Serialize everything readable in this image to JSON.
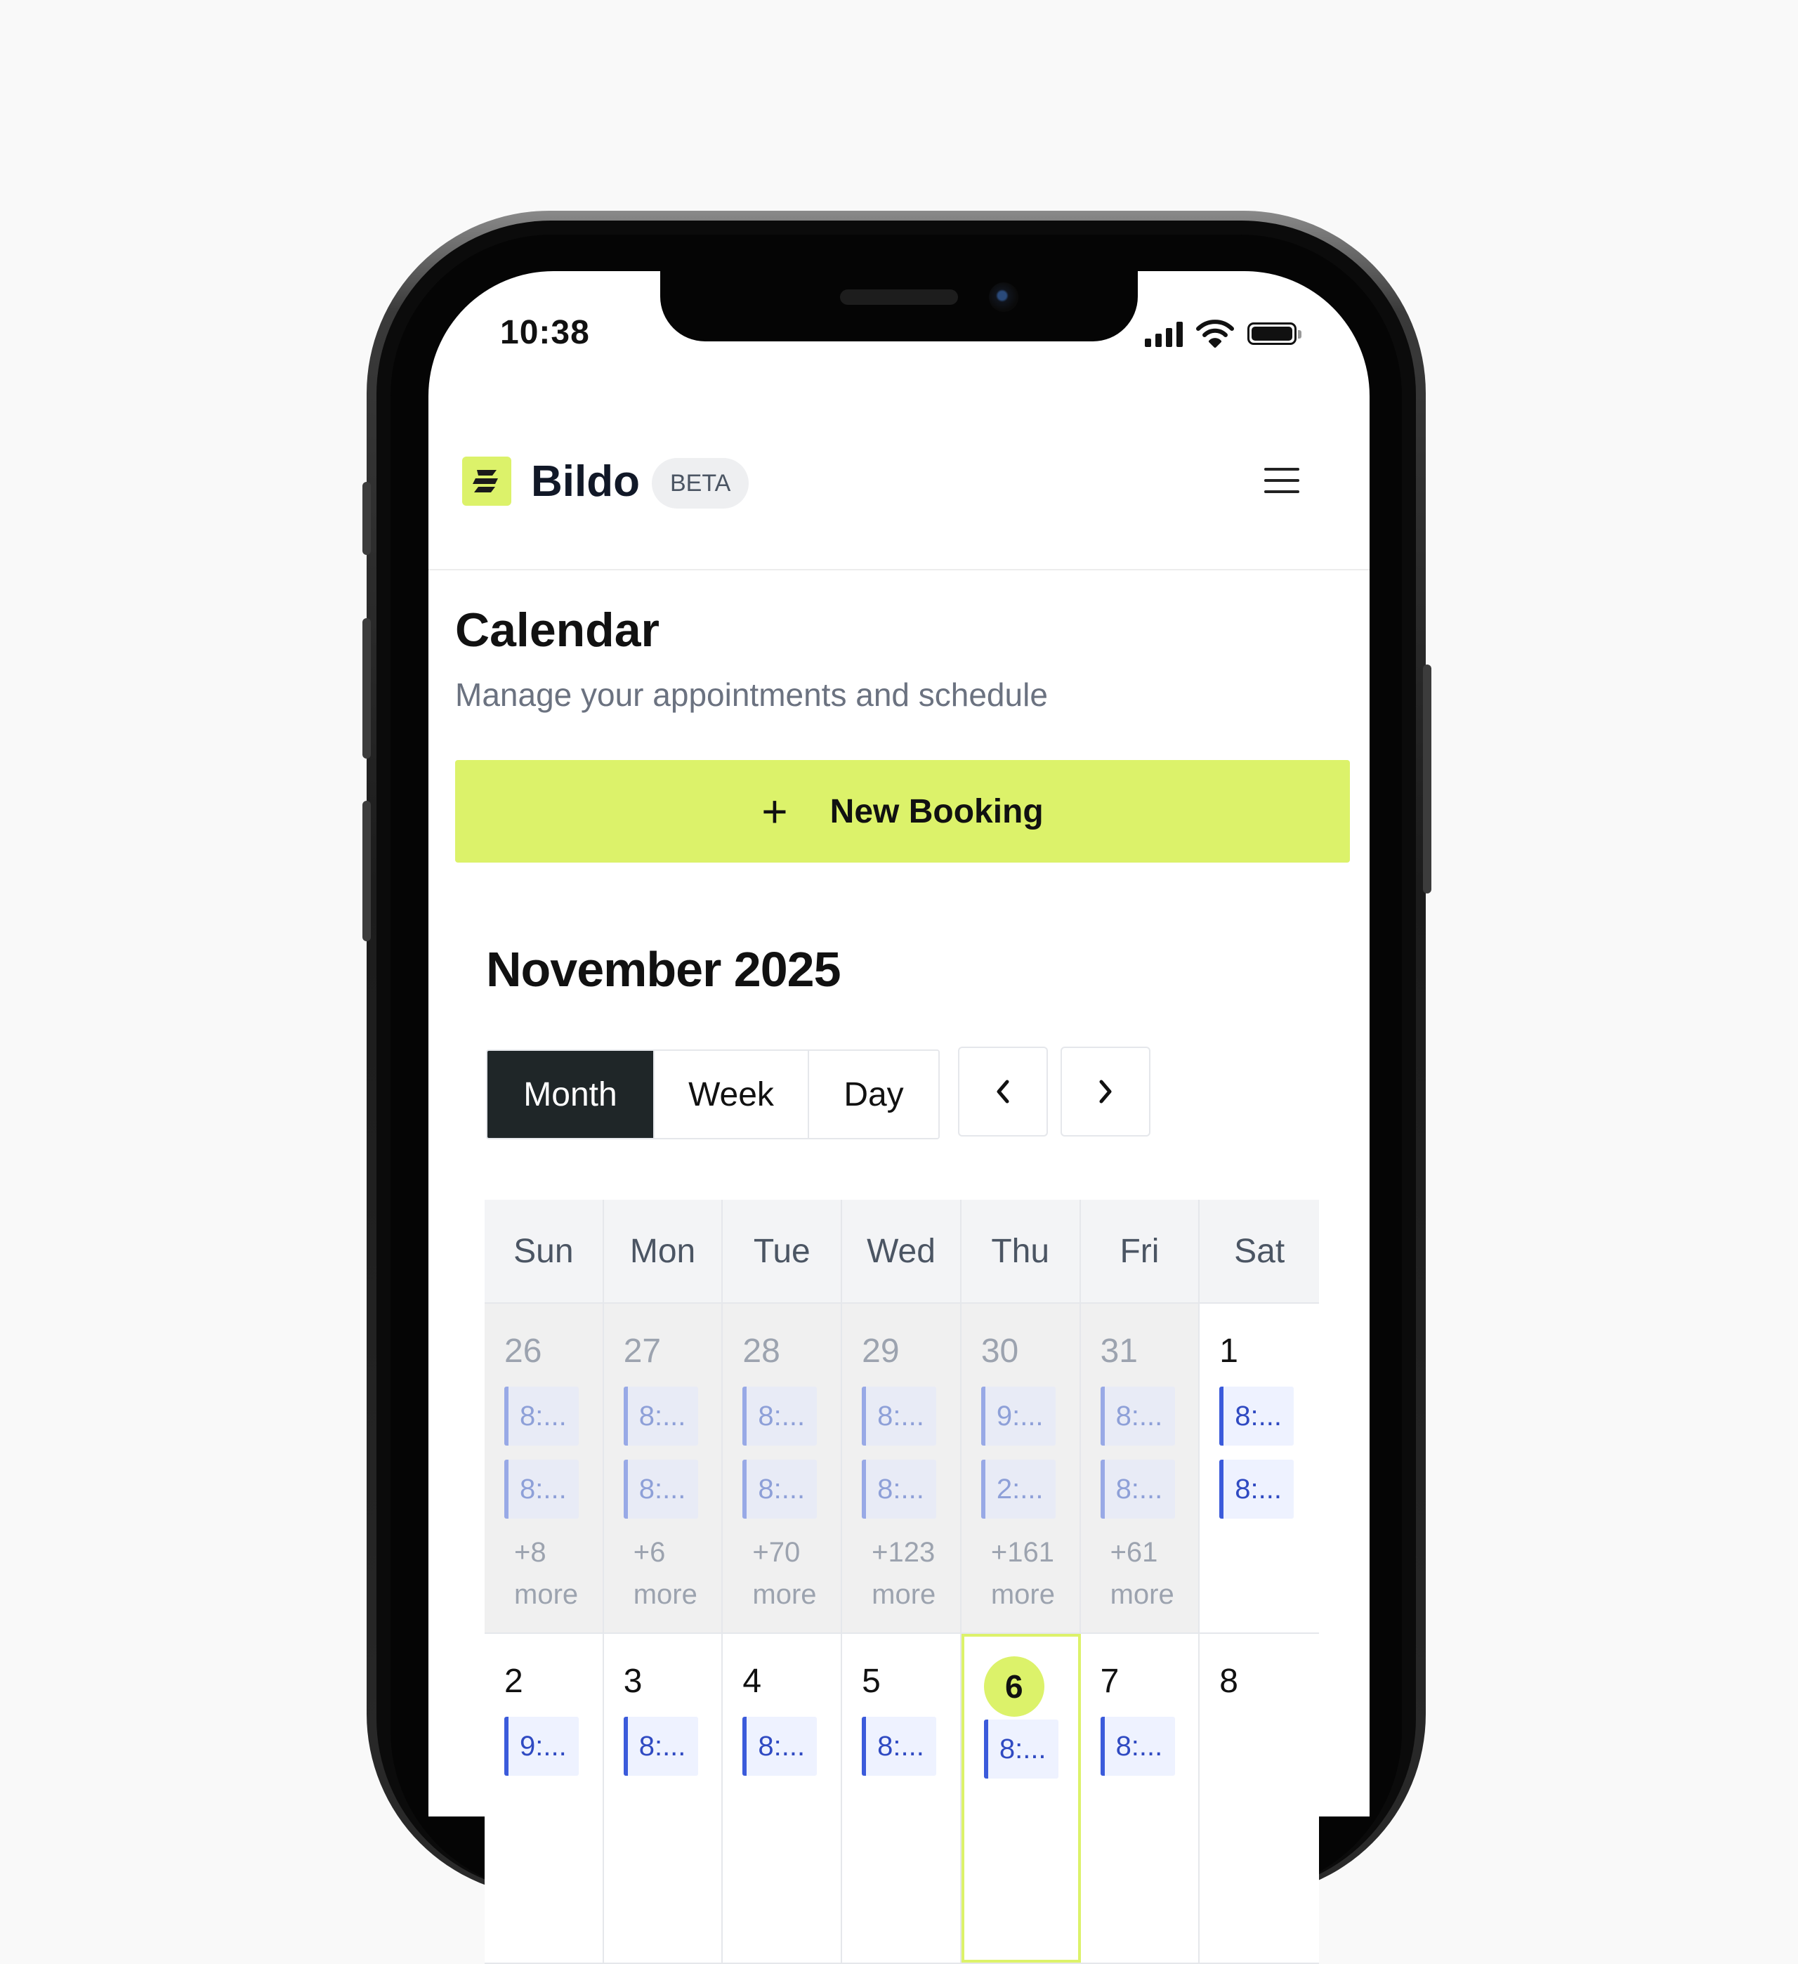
{
  "status_bar": {
    "time": "10:38"
  },
  "header": {
    "brand": "Bildo",
    "badge": "BETA",
    "menu_icon": "hamburger-icon"
  },
  "page": {
    "title": "Calendar",
    "subtitle": "Manage your appointments and schedule"
  },
  "new_booking": {
    "label": "New Booking",
    "icon": "plus-icon"
  },
  "calendar": {
    "month_label": "November 2025",
    "views": [
      "Month",
      "Week",
      "Day"
    ],
    "active_view": "Month",
    "prev": "‹",
    "next": "›",
    "weekdays": [
      "Sun",
      "Mon",
      "Tue",
      "Wed",
      "Thu",
      "Fri",
      "Sat"
    ],
    "weeks": [
      [
        {
          "day": "26",
          "other": true,
          "events": [
            "8:...",
            "8:..."
          ],
          "more": "+8\nmore"
        },
        {
          "day": "27",
          "other": true,
          "events": [
            "8:...",
            "8:..."
          ],
          "more": "+6\nmore"
        },
        {
          "day": "28",
          "other": true,
          "events": [
            "8:...",
            "8:..."
          ],
          "more": "+70\nmore"
        },
        {
          "day": "29",
          "other": true,
          "events": [
            "8:...",
            "8:..."
          ],
          "more": "+123\nmore"
        },
        {
          "day": "30",
          "other": true,
          "events": [
            "9:...",
            "2:..."
          ],
          "more": "+161\nmore"
        },
        {
          "day": "31",
          "other": true,
          "events": [
            "8:...",
            "8:..."
          ],
          "more": "+61\nmore"
        },
        {
          "day": "1",
          "other": false,
          "events": [
            "8:...",
            "8:..."
          ],
          "more": ""
        }
      ],
      [
        {
          "day": "2",
          "other": false,
          "events": [
            "9:..."
          ],
          "more": ""
        },
        {
          "day": "3",
          "other": false,
          "events": [
            "8:..."
          ],
          "more": ""
        },
        {
          "day": "4",
          "other": false,
          "events": [
            "8:..."
          ],
          "more": ""
        },
        {
          "day": "5",
          "other": false,
          "events": [
            "8:..."
          ],
          "more": ""
        },
        {
          "day": "6",
          "other": false,
          "today": true,
          "events": [
            "8:..."
          ],
          "more": ""
        },
        {
          "day": "7",
          "other": false,
          "events": [
            "8:..."
          ],
          "more": ""
        },
        {
          "day": "8",
          "other": false,
          "events": [],
          "more": ""
        }
      ]
    ]
  },
  "colors": {
    "accent": "#dcf26a",
    "dark": "#1f2628",
    "event_blue": "#3b5bdb"
  }
}
